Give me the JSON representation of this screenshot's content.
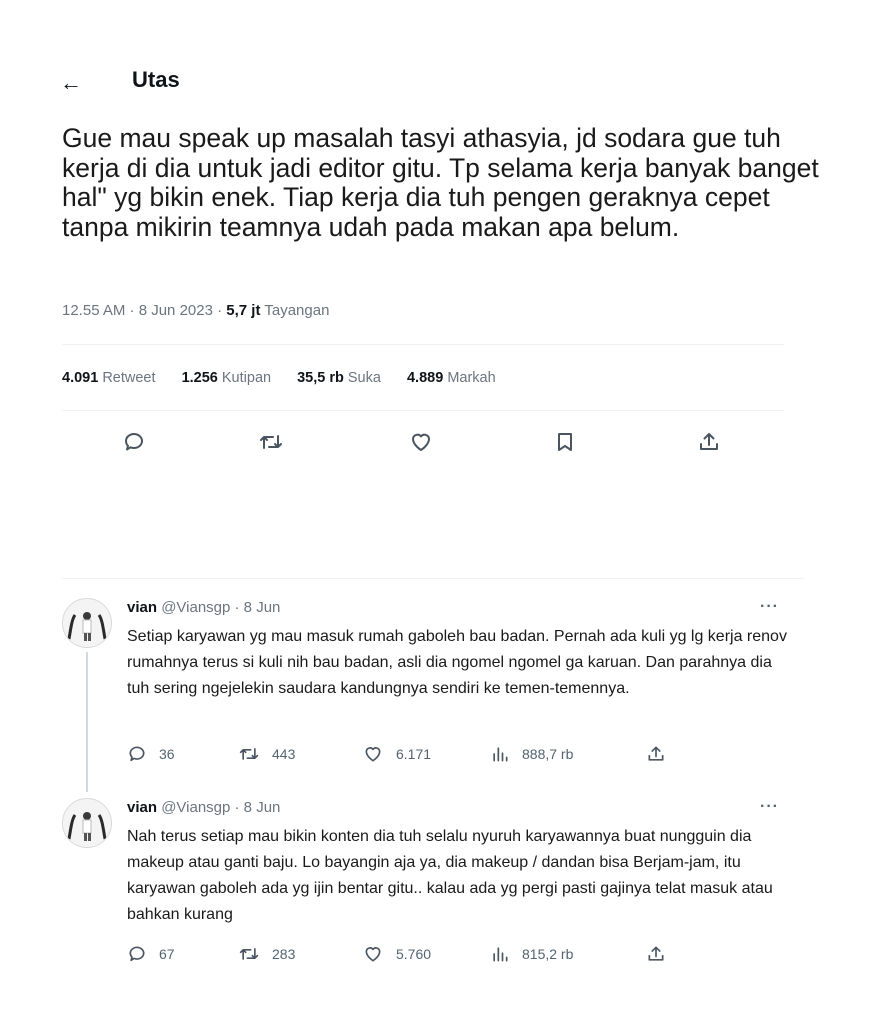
{
  "header": {
    "title": "Utas"
  },
  "tweet": {
    "text": "Gue mau speak up masalah tasyi athasyia, jd sodara gue tuh kerja di dia untuk jadi editor gitu. Tp selama kerja banyak banget hal\" yg bikin enek. Tiap kerja dia tuh pengen geraknya cepet tanpa mikirin teamnya udah pada makan apa belum.",
    "timestamp": "12.55 AM · 8 Jun 2023 · ",
    "views_count": "5,7 jt",
    "views_label": "Tayangan",
    "stats": {
      "retweets": "4.091",
      "retweets_label": "Retweet",
      "quotes": "1.256",
      "quotes_label": "Kutipan",
      "likes": "35,5 rb",
      "likes_label": "Suka",
      "bookmarks": "4.889",
      "bookmarks_label": "Markah"
    },
    "action_icons": [
      "reply-icon",
      "retweet-icon",
      "like-icon",
      "bookmark-icon",
      "share-icon"
    ]
  },
  "replies": [
    {
      "name": "vian",
      "handle": "@Viansgp · 8 Jun",
      "more": "···",
      "text": "Setiap karyawan yg mau masuk rumah gaboleh bau badan. Pernah ada kuli yg lg kerja renov rumahnya terus si kuli nih bau badan, asli dia ngomel ngomel ga karuan. Dan parahnya dia tuh sering ngejelekin saudara kandungnya sendiri ke temen-temennya.",
      "replies": "36",
      "retweets": "443",
      "likes": "6.171",
      "views": "888,7 rb"
    },
    {
      "name": "vian",
      "handle": "@Viansgp · 8 Jun",
      "more": "···",
      "text": "Nah terus setiap mau bikin konten dia tuh selalu nyuruh karyawannya buat nungguin dia makeup atau ganti baju. Lo bayangin aja ya, dia makeup / dandan bisa Berjam-jam, itu karyawan gaboleh ada yg ijin bentar gitu.. kalau ada yg pergi pasti gajinya telat masuk atau bahkan kurang",
      "replies": "67",
      "retweets": "283",
      "likes": "5.760",
      "views": "815,2 rb"
    }
  ]
}
